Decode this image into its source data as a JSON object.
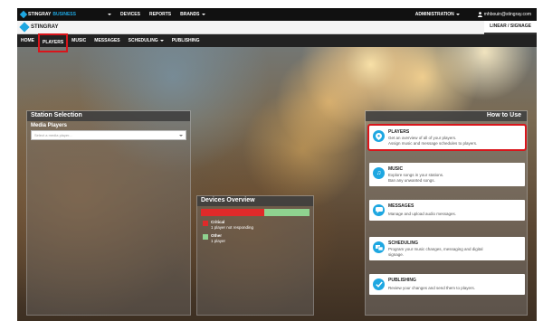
{
  "topbar": {
    "brand_a": "STINGRAY",
    "brand_b": "BUSINESS",
    "nav": [
      "DEVICES",
      "REPORTS",
      "BRANDS"
    ],
    "admin": "ADMINISTRATION",
    "user": "mhbouin@stingray.com"
  },
  "brandbar": {
    "logo": "STINGRAY",
    "mode": "LINEAR / SIGNAGE"
  },
  "navbar": {
    "items": [
      {
        "label": "HOME"
      },
      {
        "label": "PLAYERS"
      },
      {
        "label": "MUSIC"
      },
      {
        "label": "MESSAGES"
      },
      {
        "label": "SCHEDULING"
      },
      {
        "label": "PUBLISHING"
      }
    ]
  },
  "station": {
    "title": "Station Selection",
    "subtitle": "Media Players",
    "placeholder": "Select a media player..."
  },
  "devices": {
    "title": "Devices Overview",
    "critical_fraction": 0.58,
    "colors": {
      "critical": "#e02a2a",
      "other": "#8fd28f"
    },
    "legend": [
      {
        "label": "Critical",
        "desc": "1 player not responding"
      },
      {
        "label": "Other",
        "desc": "1 player"
      }
    ]
  },
  "howto": {
    "title": "How to Use",
    "cards": [
      {
        "title": "PLAYERS",
        "desc1": "Get an overview of all of your players.",
        "desc2": "Assign music and message schedules to players.",
        "icon": "location-pin-icon"
      },
      {
        "title": "MUSIC",
        "desc1": "Explore songs in your stations.",
        "desc2": "Ban any unwanted songs.",
        "icon": "music-note-icon"
      },
      {
        "title": "MESSAGES",
        "desc1": "Manage and upload audio messages.",
        "desc2": "",
        "icon": "speech-bubble-icon"
      },
      {
        "title": "SCHEDULING",
        "desc1": "Program your music changes, messaging and digital",
        "desc2": "signage.",
        "icon": "schedule-icon"
      },
      {
        "title": "PUBLISHING",
        "desc1": "Review your changes and send them to players.",
        "desc2": "",
        "icon": "checkmark-icon"
      }
    ]
  },
  "accent": "#1ea7e1",
  "highlight": "#d9151b"
}
